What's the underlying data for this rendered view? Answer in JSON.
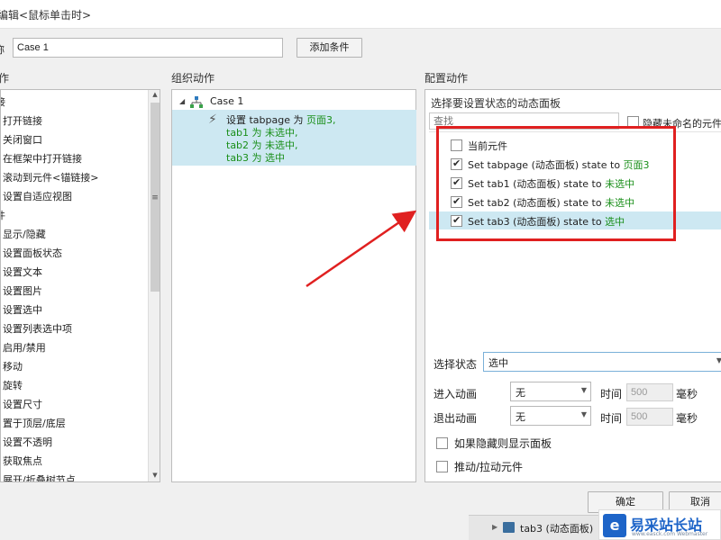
{
  "window": {
    "title": "编辑<鼠标单击时>"
  },
  "case_name": {
    "label": "称",
    "value": "Case 1",
    "add_condition_label": "添加条件"
  },
  "sections": {
    "left": "作",
    "middle": "组织动作",
    "right": "配置动作"
  },
  "left_tree": [
    {
      "text": "接",
      "indent": 0
    },
    {
      "text": "打开链接",
      "indent": 1
    },
    {
      "text": "关闭窗口",
      "indent": 1
    },
    {
      "text": "在框架中打开链接",
      "indent": 1
    },
    {
      "text": "滚动到元件<锚链接>",
      "indent": 1
    },
    {
      "text": "设置自适应视图",
      "indent": 1
    },
    {
      "text": "件",
      "indent": 0
    },
    {
      "text": "显示/隐藏",
      "indent": 1
    },
    {
      "text": "设置面板状态",
      "indent": 1
    },
    {
      "text": "设置文本",
      "indent": 1
    },
    {
      "text": "设置图片",
      "indent": 1
    },
    {
      "text": "设置选中",
      "indent": 1
    },
    {
      "text": "设置列表选中项",
      "indent": 1
    },
    {
      "text": "启用/禁用",
      "indent": 1
    },
    {
      "text": "移动",
      "indent": 1
    },
    {
      "text": "旋转",
      "indent": 1
    },
    {
      "text": "设置尺寸",
      "indent": 1
    },
    {
      "text": "置于顶层/底层",
      "indent": 1
    },
    {
      "text": "设置不透明",
      "indent": 1
    },
    {
      "text": "获取焦点",
      "indent": 1
    },
    {
      "text": "展开/折叠树节点",
      "indent": 1
    }
  ],
  "organize": {
    "case_label": "Case 1",
    "action": {
      "l1a": "设置 tabpage 为 ",
      "l1b": "页面3,",
      "l2a": "tab1 为 ",
      "l2b": "未选中,",
      "l3a": "tab2 为 ",
      "l3b": "未选中,",
      "l4a": "tab3 为 ",
      "l4b": "选中"
    }
  },
  "configure": {
    "panel_title": "选择要设置状态的动态面板",
    "filter_placeholder": "查找",
    "hide_unnamed_label": "隐藏未命名的元件",
    "rows": [
      {
        "checked": false,
        "text": "当前元件",
        "value": ""
      },
      {
        "checked": true,
        "text": "Set tabpage (动态面板) state to ",
        "value": "页面3"
      },
      {
        "checked": true,
        "text": "Set tab1 (动态面板) state to ",
        "value": "未选中"
      },
      {
        "checked": true,
        "text": "Set tab2 (动态面板) state to ",
        "value": "未选中"
      },
      {
        "checked": true,
        "text": "Set tab3 (动态面板) state to ",
        "value": "选中",
        "selected": true
      }
    ],
    "select_state_label": "选择状态",
    "select_state_value": "选中",
    "enter_anim_label": "进入动画",
    "enter_anim_value": "无",
    "exit_anim_label": "退出动画",
    "exit_anim_value": "无",
    "time_label": "时间",
    "time_value": "500",
    "ms_label": "毫秒",
    "show_if_hidden_label": "如果隐藏则显示面板",
    "push_pull_label": "推动/拉动元件"
  },
  "buttons": {
    "ok": "确定",
    "cancel": "取消"
  },
  "bottom_strip": {
    "text": "tab3 (动态面板)"
  },
  "watermark": {
    "brand": "易采站长站",
    "url": "www.easck.com Webmaster"
  },
  "colors": {
    "highlight_bg": "#cde8f2",
    "green": "#1a8f1a",
    "annotation_red": "#e02020"
  }
}
